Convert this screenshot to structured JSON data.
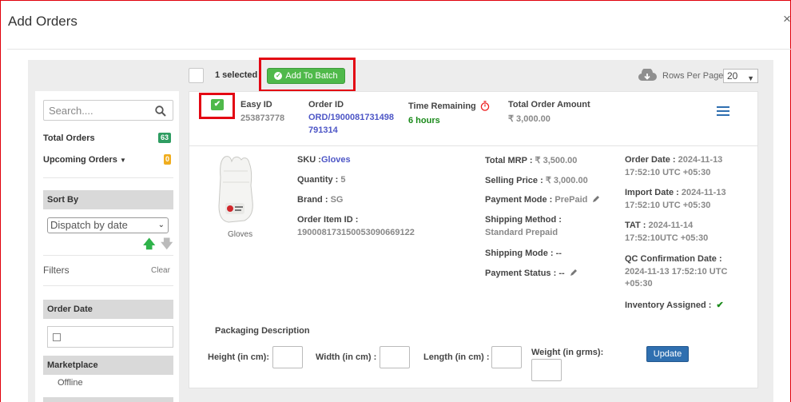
{
  "modal": {
    "title": "Add Orders",
    "close": "×"
  },
  "toolbar": {
    "selected_text": "1 selected",
    "add_to_batch": "Add To Batch",
    "rows_per_page_label": "Rows Per Page",
    "rows_per_page_value": "20"
  },
  "sidebar": {
    "search_placeholder": "Search....",
    "total_orders_label": "Total Orders",
    "total_orders_count": "63",
    "upcoming_orders_label": "Upcoming Orders",
    "upcoming_orders_count": "0",
    "sort_by_label": "Sort By",
    "sort_by_value": "Dispatch by date",
    "filters_label": "Filters",
    "clear_label": "Clear",
    "order_date_label": "Order Date",
    "marketplace_label": "Marketplace",
    "marketplace_value": "Offline"
  },
  "order": {
    "easy_id_label": "Easy ID",
    "easy_id": "253873778",
    "order_id_label": "Order ID",
    "order_id_line1": "ORD/1900081731498",
    "order_id_line2": "791314",
    "time_remaining_label": "Time Remaining",
    "time_remaining": "6 hours",
    "total_amount_label": "Total Order Amount",
    "total_amount": "₹ 3,000.00",
    "product_name": "Gloves",
    "sku_label": "SKU :",
    "sku": "Gloves",
    "quantity_label": "Quantity :",
    "quantity": "5",
    "brand_label": "Brand :",
    "brand": "SG",
    "order_item_id_label": "Order Item ID :",
    "order_item_id": "1900081731500530906691​22",
    "total_mrp_label": "Total MRP :",
    "total_mrp": "₹ 3,500.00",
    "selling_price_label": "Selling Price :",
    "selling_price": "₹ 3,000.00",
    "payment_mode_label": "Payment Mode :",
    "payment_mode": "PrePaid",
    "shipping_method_label": "Shipping Method :",
    "shipping_method": "Standard Prepaid",
    "shipping_mode_label": "Shipping Mode :",
    "shipping_mode": "--",
    "payment_status_label": "Payment Status :",
    "payment_status": "--",
    "order_date_label": "Order Date :",
    "order_date_1": "2024-11-13",
    "order_date_2": "17:52:10 UTC +05:30",
    "import_date_label": "Import Date :",
    "import_date_1": "2024-11-13",
    "import_date_2": "17:52:10 UTC +05:30",
    "tat_label": "TAT :",
    "tat_1": "2024-11-14",
    "tat_2": "17:52:10UTC +05:30",
    "qc_label": "QC Confirmation Date :",
    "qc_1": "2024-11-13 17:52:10 UTC",
    "qc_2": "+05:30",
    "inventory_label": "Inventory Assigned :"
  },
  "packaging": {
    "title": "Packaging Description",
    "height_label": "Height (in cm):",
    "width_label": "Width (in cm) :",
    "length_label": "Length (in cm) :",
    "weight_label": "Weight (in grms):",
    "update": "Update"
  },
  "colors": {
    "accent_green": "#4fb94a",
    "accent_blue": "#2f6fb0",
    "highlight_red": "#e30613",
    "link_purple": "#4d56c6"
  }
}
